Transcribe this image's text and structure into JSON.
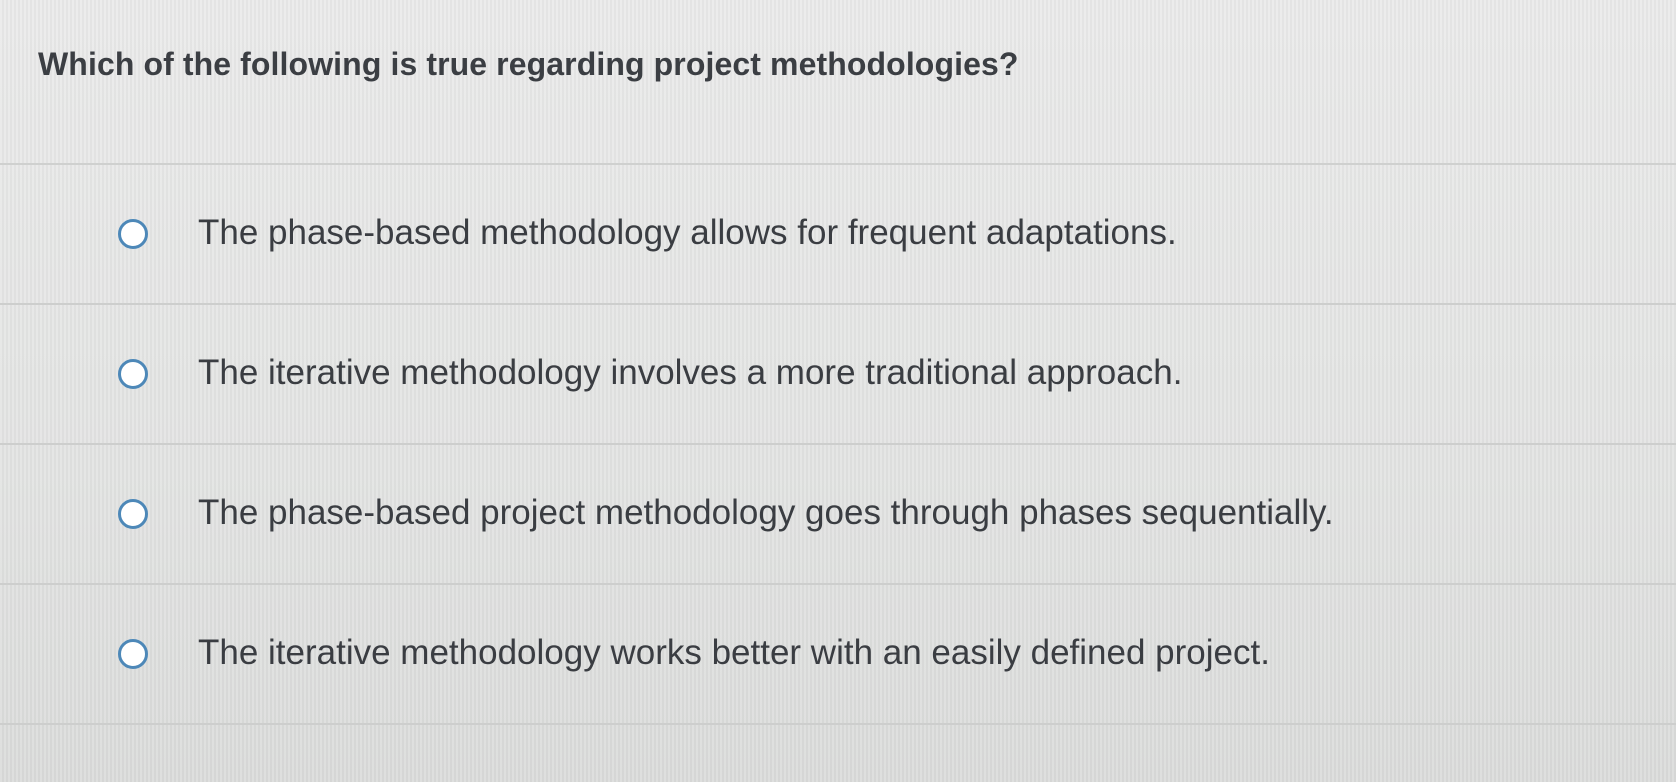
{
  "question": {
    "text": "Which of the following is true regarding project methodologies?"
  },
  "choices": [
    {
      "label": "The phase-based methodology allows for frequent adaptations.",
      "selected": false
    },
    {
      "label": "The iterative methodology involves a more traditional approach.",
      "selected": false
    },
    {
      "label": "The phase-based project methodology goes through phases sequentially.",
      "selected": false
    },
    {
      "label": "The iterative methodology works better with an easily defined project.",
      "selected": false
    }
  ],
  "colors": {
    "radio_border": "#4d88b8",
    "text": "#3a3d42",
    "background": "#e3e4e3",
    "divider": "#cdcecd"
  }
}
